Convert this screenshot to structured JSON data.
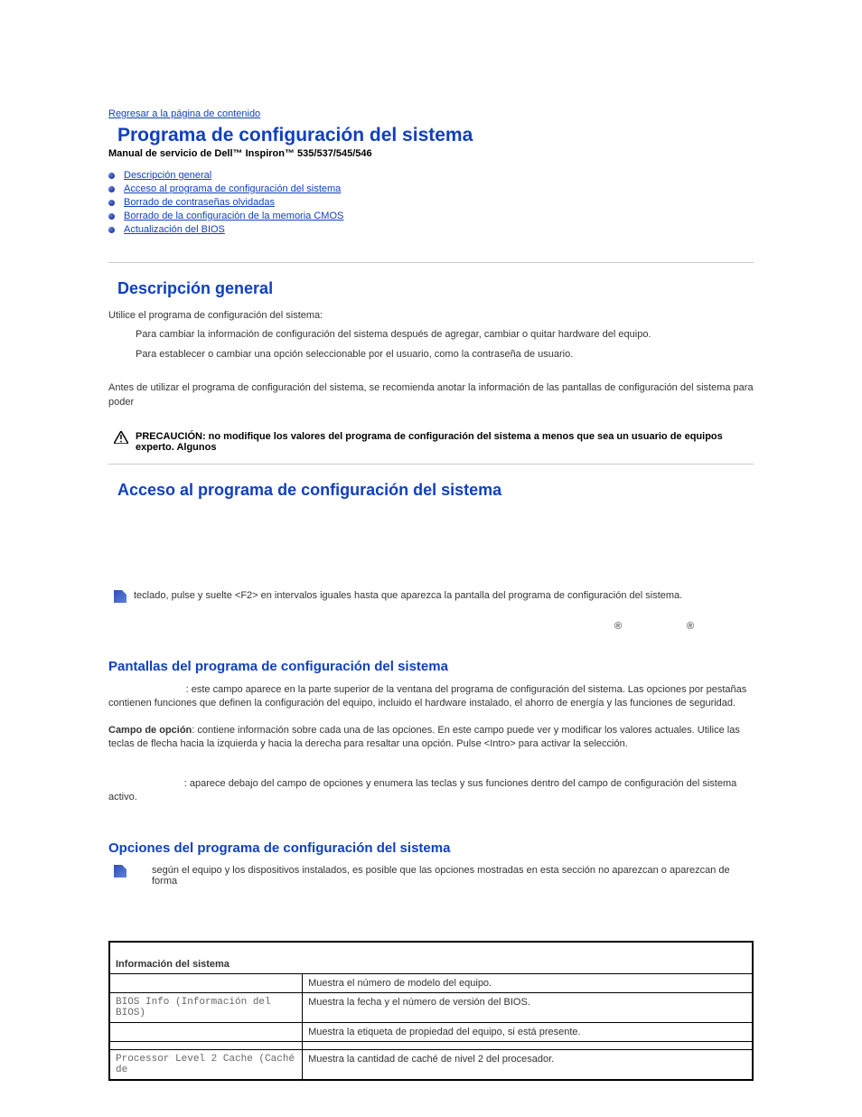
{
  "back_link": "Regresar a la página de contenido",
  "title": "Programa de configuración del sistema",
  "subtitle": "Manual de servicio de Dell™ Inspiron™ 535/537/545/546",
  "toc": [
    "Descripción general",
    "Acceso al programa de configuración del sistema",
    "Borrado de contraseñas olvidadas",
    "Borrado de la configuración de la memoria CMOS",
    "Actualización del BIOS"
  ],
  "s1": {
    "heading": "Descripción general",
    "intro": "Utilice el programa de configuración del sistema:",
    "bullet1": "Para cambiar la información de configuración del sistema después de agregar, cambiar o quitar hardware del equipo.",
    "bullet2": "Para establecer o cambiar una opción seleccionable por el usuario, como la contraseña de usuario.",
    "para": "Antes de utilizar el programa de configuración del sistema, se recomienda anotar la información de las pantallas de configuración del sistema para poder",
    "caution_label": "PRECAUCIÓN:",
    "caution": " no modifique los valores del programa de configuración del sistema a menos que sea un usuario de equipos experto. Algunos"
  },
  "s2": {
    "heading": "Acceso al programa de configuración del sistema",
    "note": "teclado, pulse y suelte <F2> en intervalos iguales hasta que aparezca la pantalla del programa de configuración del sistema."
  },
  "s3": {
    "heading": "Pantallas del programa de configuración del sistema",
    "p1": ": este campo aparece en la parte superior de la ventana del programa de configuración del sistema. Las opciones por pestañas contienen funciones que definen la configuración del equipo, incluido el hardware instalado, el ahorro de energía y las funciones de seguridad.",
    "p2_label": "Campo de opción",
    "p2": ": contiene información sobre cada una de las opciones. En este campo puede ver y modificar los valores actuales. Utilice las teclas de flecha hacia la izquierda y hacia la derecha para resaltar una opción. Pulse <Intro> para activar la selección.",
    "p3": ": aparece debajo del campo de opciones y enumera las teclas y sus funciones dentro del campo de configuración del sistema activo."
  },
  "s4": {
    "heading": "Opciones del programa de configuración del sistema",
    "note": "según el equipo y los dispositivos instalados, es posible que las opciones mostradas en esta sección no aparezcan o aparezcan de forma"
  },
  "table": {
    "header": "Información del sistema",
    "rows": [
      {
        "l": "",
        "r": "Muestra el número de modelo del equipo."
      },
      {
        "l": "BIOS Info (Información del BIOS)",
        "r": "Muestra la fecha y el número de versión del BIOS."
      },
      {
        "l": "",
        "r": "Muestra la etiqueta de propiedad del equipo, si está presente."
      },
      {
        "l": "",
        "r": ""
      },
      {
        "l": "Processor Level 2 Cache (Caché de",
        "r": "Muestra la cantidad de caché de nivel 2 del procesador."
      }
    ]
  },
  "reg_symbol": "®"
}
